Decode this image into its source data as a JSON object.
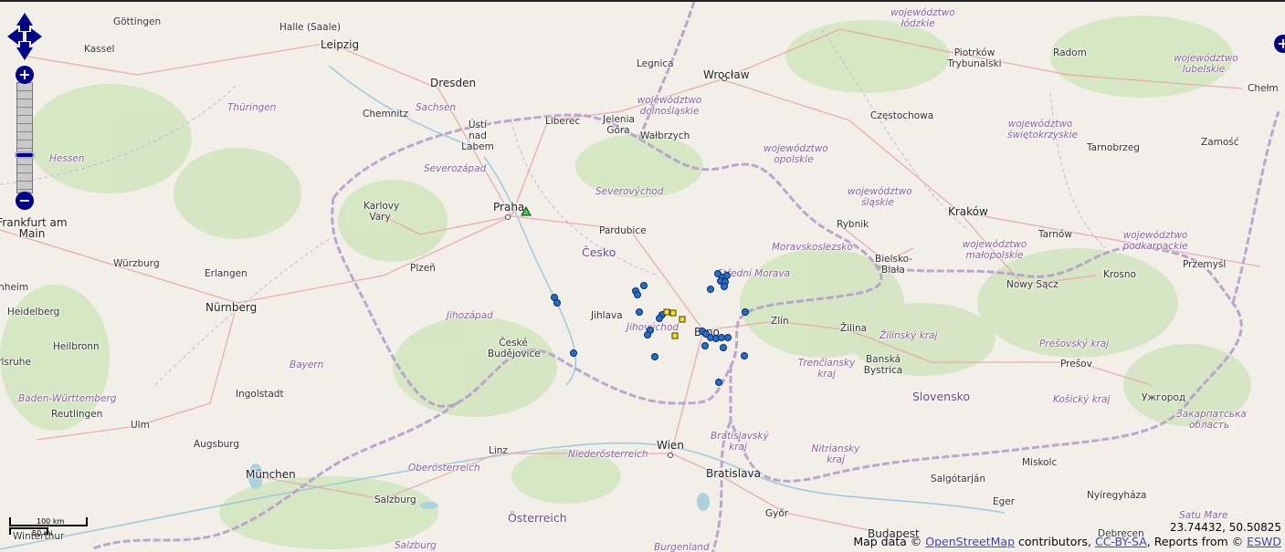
{
  "colors": {
    "land": "#f2efe9",
    "green": "#cfe3bc",
    "water": "#aad3df",
    "border": "#b7a2cc",
    "road": "#e5a3a3",
    "motorway": "#e892a2",
    "marker_blue": "#1f6fd6",
    "marker_yellow": "#f5e218",
    "marker_green": "#4ec24e",
    "control": "#00008b"
  },
  "icons": {
    "pan": "pan-arrows-icon",
    "zoom_in": "plus-icon",
    "zoom_out": "minus-icon",
    "layers": "plus-icon"
  },
  "controls": {
    "zoom_in_label": "+",
    "zoom_out_label": "−",
    "layers_label": "+"
  },
  "scale": {
    "top": "100 km",
    "bottom": "50 mi"
  },
  "coordinates": "23.74432, 50.50825",
  "attribution": {
    "prefix": "Map data ©",
    "osm": "OpenStreetMap",
    "mid": " contributors, ",
    "license": "CC-BY-SA",
    "reports": ", Reports from © ",
    "source": "ESWD"
  },
  "cities": [
    {
      "name": "Göttingen"
    },
    {
      "name": "Halle (Saale)"
    },
    {
      "name": "Kassel"
    },
    {
      "name": "Leipzig"
    },
    {
      "name": "Legnica"
    },
    {
      "name": "Wrocław"
    },
    {
      "name": "Piotrków Trybunalski"
    },
    {
      "name": "Radom"
    },
    {
      "name": "Chełm"
    },
    {
      "name": "Dresden"
    },
    {
      "name": "Chemnitz"
    },
    {
      "name": "Ústí nad Labem"
    },
    {
      "name": "Liberec"
    },
    {
      "name": "Jelenia Góra"
    },
    {
      "name": "Wałbrzych"
    },
    {
      "name": "Częstochowa"
    },
    {
      "name": "Zamość"
    },
    {
      "name": "Tarnobrzeg"
    },
    {
      "name": "Karlovy Vary"
    },
    {
      "name": "Praha"
    },
    {
      "name": "Pardubice"
    },
    {
      "name": "Rybnik"
    },
    {
      "name": "Kraków"
    },
    {
      "name": "Tarnów"
    },
    {
      "name": "Frankfurt am Main"
    },
    {
      "name": "Würzburg"
    },
    {
      "name": "Erlangen"
    },
    {
      "name": "Plzeň"
    },
    {
      "name": "Bielsko-Biała"
    },
    {
      "name": "Nowy Sącz"
    },
    {
      "name": "Krosno"
    },
    {
      "name": "Przemyśl"
    },
    {
      "name": "Mannheim"
    },
    {
      "name": "Heidelberg"
    },
    {
      "name": "Nürnberg"
    },
    {
      "name": "Jihlava"
    },
    {
      "name": "Zlín"
    },
    {
      "name": "Žilina"
    },
    {
      "name": "Heilbronn"
    },
    {
      "name": "České Budějovice"
    },
    {
      "name": "Brno"
    },
    {
      "name": "Prešov"
    },
    {
      "name": "Karlsruhe"
    },
    {
      "name": "Banská Bystrica"
    },
    {
      "name": "Ingolstadt"
    },
    {
      "name": "Reutlingen"
    },
    {
      "name": "Ulm"
    },
    {
      "name": "Ужгород"
    },
    {
      "name": "Augsburg"
    },
    {
      "name": "Linz"
    },
    {
      "name": "Wien"
    },
    {
      "name": "München"
    },
    {
      "name": "Bratislava"
    },
    {
      "name": "Miskolc"
    },
    {
      "name": "Salgótarján"
    },
    {
      "name": "Salzburg"
    },
    {
      "name": "Eger"
    },
    {
      "name": "Nyíregyháza"
    },
    {
      "name": "Győr"
    },
    {
      "name": "Budapest"
    },
    {
      "name": "Debrecen"
    },
    {
      "name": "Winterthur"
    }
  ],
  "regions": [
    {
      "name": "województwo łódzkie"
    },
    {
      "name": "województwo lubelskie"
    },
    {
      "name": "Thüringen"
    },
    {
      "name": "Sachsen"
    },
    {
      "name": "województwo dolnośląskie"
    },
    {
      "name": "województwo świętokrzyskie"
    },
    {
      "name": "Hessen"
    },
    {
      "name": "Severozápad"
    },
    {
      "name": "województwo opolskie"
    },
    {
      "name": "Severovýchod"
    },
    {
      "name": "województwo śląskie"
    },
    {
      "name": "województwo małopolskie"
    },
    {
      "name": "województwo podkarpackie"
    },
    {
      "name": "Moravskoslezsko"
    },
    {
      "name": "Střední Morava"
    },
    {
      "name": "Jihozápad"
    },
    {
      "name": "Jihovýchod"
    },
    {
      "name": "Žilinský kraj"
    },
    {
      "name": "Prešovský kraj"
    },
    {
      "name": "Bayern"
    },
    {
      "name": "Trenčiansky kraj"
    },
    {
      "name": "Košický kraj"
    },
    {
      "name": "Baden-Württemberg"
    },
    {
      "name": "Закарпатська область"
    },
    {
      "name": "Bratislavský kraj"
    },
    {
      "name": "Nitriansky kraj"
    },
    {
      "name": "Niederösterreich"
    },
    {
      "name": "Oberösterreich"
    },
    {
      "name": "Satu Mare"
    },
    {
      "name": "Salzburg"
    },
    {
      "name": "Burgenland"
    },
    {
      "name": "Lubelskie"
    }
  ],
  "countries": [
    {
      "name": "Česko"
    },
    {
      "name": "Slovensko"
    },
    {
      "name": "Österreich"
    }
  ],
  "report_counts": {
    "blue": 34,
    "yellow": 6,
    "green": 1
  }
}
